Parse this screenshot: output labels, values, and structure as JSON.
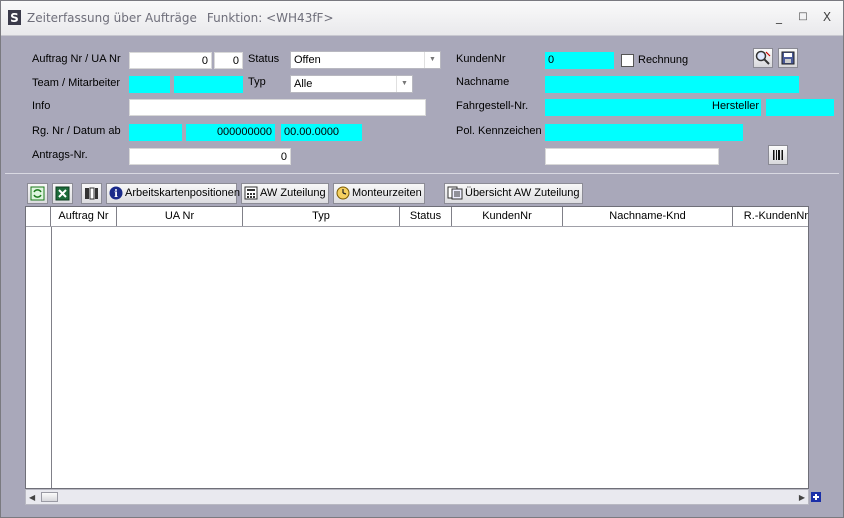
{
  "window": {
    "title": "Zeiterfassung über Aufträge",
    "function_label": "Funktion: <WH43fF>",
    "minimize": "_",
    "maximize": "□",
    "close": "X"
  },
  "form": {
    "auftrag_label": "Auftrag Nr  / UA Nr",
    "auftrag_value": "0",
    "ua_value": "0",
    "status_label": "Status",
    "status_value": "Offen",
    "team_label": "Team / Mitarbeiter",
    "typ_label": "Typ",
    "typ_value": "Alle",
    "info_label": "Info",
    "info_value": "",
    "rg_label": "Rg. Nr / Datum ab",
    "rg_nr_value": "000000000",
    "datum_value": "00.00.0000",
    "antrags_label": "Antrags-Nr.",
    "antrags_value": "0",
    "kunden_label": "KundenNr",
    "kunden_value": "0",
    "rechnung_label": "Rechnung",
    "rechnung_checked": false,
    "nachname_label": "Nachname",
    "fahrgestell_label": "Fahrgestell-Nr.",
    "hersteller_label": "Hersteller",
    "pol_label": "Pol. Kennzeichen"
  },
  "toolbar": {
    "arbeitskarten": "Arbeitskartenpositionen",
    "aw_zuteilung": "AW Zuteilung",
    "monteurzeiten": "Monteurzeiten",
    "uebersicht": "Übersicht AW Zuteilung"
  },
  "grid": {
    "columns": [
      "Auftrag Nr",
      "UA Nr",
      "Typ",
      "Status",
      "KundenNr",
      "Nachname-Knd",
      "R.-KundenNr"
    ],
    "rows": []
  },
  "icons": {
    "app": "app-s-icon",
    "search": "magnifier-icon",
    "save": "floppy-icon",
    "barcode": "barcode-icon",
    "refresh": "refresh-icon",
    "excel": "excel-icon",
    "columns": "columns-icon",
    "info": "info-icon",
    "calc": "calculator-icon",
    "clock": "clock-icon",
    "overview": "overview-icon",
    "plus": "plus-icon"
  },
  "colors": {
    "form_bg": "#a9a8ba",
    "highlight_field": "#00ffff",
    "plus_blue": "#1a2fa8"
  }
}
